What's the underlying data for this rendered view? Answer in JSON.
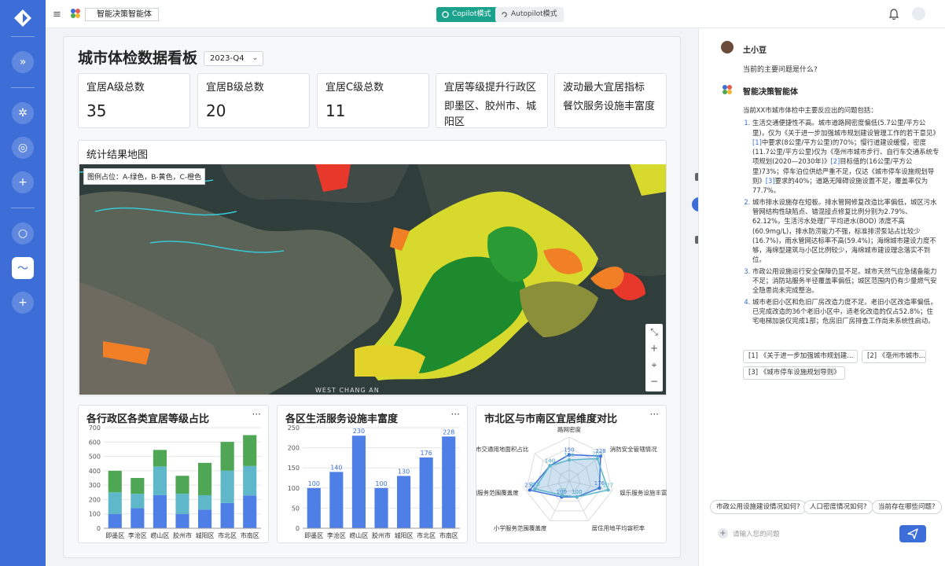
{
  "topbar": {
    "app_title": "智能决策智能体",
    "copilot_label": "Copilot模式",
    "autopilot_label": "Autopilot模式"
  },
  "dashboard": {
    "title": "城市体检数据看板",
    "period": "2023-Q4",
    "stats": [
      {
        "label": "宜居A级总数",
        "value": "35"
      },
      {
        "label": "宜居B级总数",
        "value": "20"
      },
      {
        "label": "宜居C级总数",
        "value": "11"
      },
      {
        "label": "宜居等级提升行政区",
        "value": "即墨区、胶州市、城阳区"
      },
      {
        "label": "波动最大宜居指标",
        "value": "餐饮服务设施丰富度"
      }
    ],
    "map": {
      "title": "统计结果地图",
      "legend": "图例占位：A-绿色，B-黄色，C-橙色",
      "place_label": "WEST CHANG AN"
    }
  },
  "chart_data": [
    {
      "type": "bar",
      "title": "各行政区各类宜居等级占比",
      "stacked": true,
      "categories": [
        "即墨区",
        "李沧区",
        "崂山区",
        "胶州市",
        "城阳区",
        "市北区",
        "市南区"
      ],
      "series": [
        {
          "values": [
            100,
            140,
            230,
            100,
            130,
            176,
            228
          ],
          "color": "#4e7fe6"
        },
        {
          "values": [
            150,
            100,
            200,
            140,
            100,
            225,
            205
          ],
          "color": "#5fb8c9"
        },
        {
          "values": [
            150,
            110,
            115,
            125,
            225,
            200,
            215
          ],
          "color": "#4fa755"
        }
      ],
      "ylim": [
        0,
        700
      ],
      "yticks": [
        0,
        100,
        200,
        300,
        400,
        500,
        600,
        700
      ]
    },
    {
      "type": "bar",
      "title": "各区生活服务设施丰富度",
      "categories": [
        "即墨区",
        "李沧区",
        "崂山区",
        "胶州市",
        "城阳区",
        "市北区",
        "市南区"
      ],
      "values": [
        100,
        140,
        230,
        100,
        130,
        176,
        228
      ],
      "color": "#4e7fe6",
      "ylim": [
        0,
        250
      ],
      "yticks": [
        0,
        50,
        100,
        150,
        200,
        250
      ]
    },
    {
      "type": "radar",
      "title": "市北区与市南区宜居维度对比",
      "axes": [
        "路网密度",
        "消防安全管辖情况",
        "娱乐服务设施丰富度",
        "居住用地平均容积率",
        "小学服务范围覆盖度",
        "公园服务范围覆盖度",
        "城市交通用地面积占比"
      ],
      "axis_labels": [
        "路网密度",
        "消防安全管辖情况",
        "娱乐服务设施丰富",
        "居住用地平均容积率",
        "小学服务范围覆盖度",
        "园服务范围覆盖度",
        "市交通用地面积占比"
      ],
      "max": 250,
      "series": [
        {
          "values": [
            150,
            228,
            176,
            100,
            100,
            230,
            140
          ],
          "color": "#3a6fd8"
        },
        {
          "values": [
            120,
            205,
            227,
            100,
            90,
            200,
            140
          ],
          "color": "#5fb8c9"
        }
      ]
    }
  ],
  "chat": {
    "user_name": "土小豆",
    "question": "当前的主要问题是什么?",
    "agent_name": "智能决策智能体",
    "intro": "当前XX市城市体检中主要反应出的问题包括：",
    "items": [
      {
        "a": "生活交通便捷性不高。城市道路网密度偏低(5.7公里/平方公里)，仅为《关于进一步加强城市规划建设管理工作的若干意见》",
        "r1": "[1]",
        "b": "中要求(8公里/平方公里)的70%；慢行道建设缓慢，密度(11.7公里/平方公里)仅为《亳州市城市步行、自行车交通系统专项规划(2020—2030年)》",
        "r2": "[2]",
        "c": "目标值的(16公里/平方公里)73%；停车泊位供给严重不足，仅达《城市停车设施规划导则》",
        "r3": "[3]",
        "d": "要求的40%；道路无障碍设施设置不足，覆盖率仅为77.7%。"
      },
      {
        "a": "城市排水设施存在短板。排水管网修复改造比率偏低，城区污水管网结构性缺陷点、错混接点修复比例分别为2.79%、62.12%，生活污水处理厂平均进水(BOD) 浓度不高(60.9mg/L)，排水防涝能力不强，标准排涝泵站占比较少(16.7%)，雨水管网达标率不高(59.4%)；海绵城市建设力度不够，海绵型建筑与小区比例较少，海绵城市建设理念落实不到位。"
      },
      {
        "a": "市政公用设施运行安全保障仍显不足。城市天然气应急储备能力不足；消防站服务半径覆盖率偏低；城区范围内仍有少量燃气安全隐患尚未完成整治。"
      },
      {
        "a": "城市老旧小区和危旧厂房改造力度不足。老旧小区改造率偏低，已完成改造的36个老旧小区中，适老化改造的仅占52.8%；住宅电梯加装仅完成1部；危房旧厂房排查工作尚未系统性启动。"
      }
    ],
    "refs": [
      "[1] 《关于进一步加强城市规划建...",
      "[2] 《亳州市城市...",
      "[3] 《城市停车设施规划导则》"
    ],
    "suggestions": [
      "市政公用设施建设情况如何?",
      "人口密度情况如何?",
      "当前存在哪些问题?"
    ],
    "input_placeholder": "请输入您的问题"
  }
}
